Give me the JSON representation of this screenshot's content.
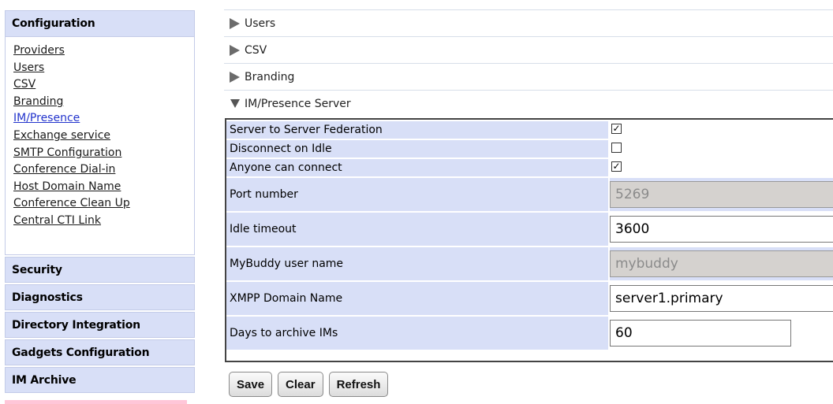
{
  "sidebar": {
    "configuration_header": "Configuration",
    "nav_items": [
      {
        "label": "Providers"
      },
      {
        "label": "Users"
      },
      {
        "label": "CSV"
      },
      {
        "label": "Branding"
      },
      {
        "label": "IM/Presence"
      },
      {
        "label": "Exchange service"
      },
      {
        "label": "SMTP Configuration"
      },
      {
        "label": "Conference Dial-in"
      },
      {
        "label": "Host Domain Name"
      },
      {
        "label": "Conference Clean Up"
      },
      {
        "label": "Central CTI Link"
      }
    ],
    "active_item": "IM/Presence",
    "sections": [
      {
        "label": "Security"
      },
      {
        "label": "Diagnostics"
      },
      {
        "label": "Directory Integration"
      },
      {
        "label": "Gadgets Configuration"
      },
      {
        "label": "IM Archive"
      }
    ]
  },
  "accordion": {
    "collapsed": [
      {
        "label": "Users"
      },
      {
        "label": "CSV"
      },
      {
        "label": "Branding"
      }
    ],
    "expanded": {
      "label": "IM/Presence Server"
    }
  },
  "form": {
    "server_federation": {
      "label": "Server to Server Federation",
      "checked": true
    },
    "disconnect_idle": {
      "label": "Disconnect on Idle",
      "checked": false
    },
    "anyone_connect": {
      "label": "Anyone can connect",
      "checked": true
    },
    "port_number": {
      "label": "Port number",
      "value": "5269"
    },
    "idle_timeout": {
      "label": "Idle timeout",
      "value": "3600"
    },
    "mybuddy": {
      "label": "MyBuddy user name",
      "value": "mybuddy"
    },
    "xmpp_domain": {
      "label": "XMPP Domain Name",
      "value": "server1.primary"
    },
    "days_archive": {
      "label": "Days to archive IMs",
      "value": "60"
    },
    "check_mark": "✓"
  },
  "buttons": {
    "save": "Save",
    "clear": "Clear",
    "refresh": "Refresh"
  },
  "colors": {
    "header_bg": "#d8dff7",
    "active_link": "#2233cc",
    "disabled_input": "#d5d2cf"
  }
}
